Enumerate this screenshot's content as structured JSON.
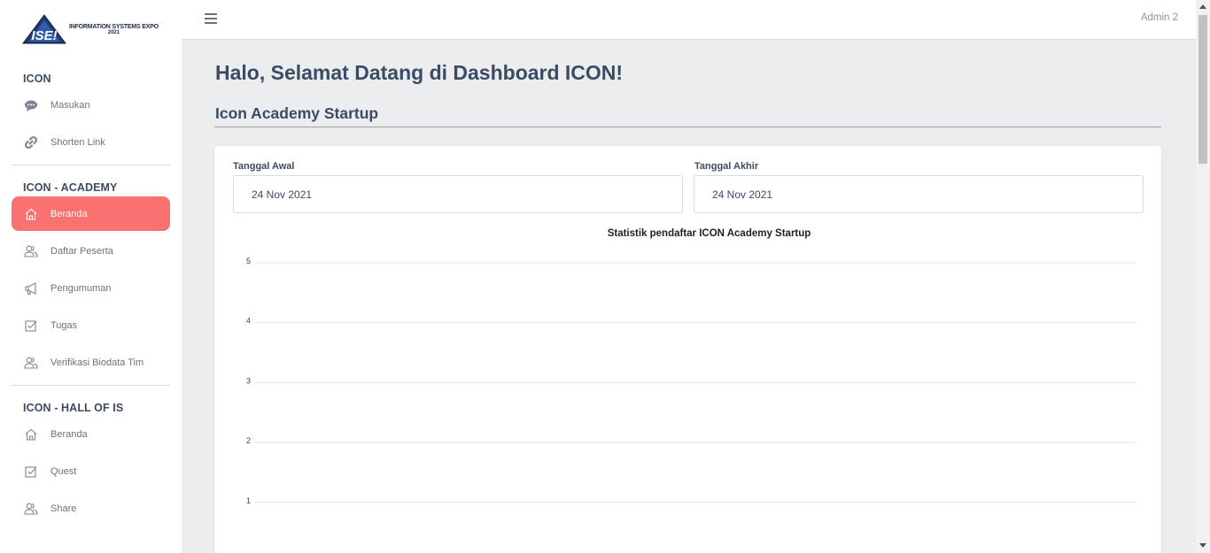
{
  "brand": {
    "logo_mark": "ISE!",
    "logo_line1": "INFORMATION SYSTEMS EXPO",
    "logo_line2": "2021"
  },
  "header": {
    "user": "Admin 2"
  },
  "sidebar": {
    "groups": [
      {
        "title": "ICON",
        "items": [
          {
            "label": "Masukan",
            "icon": "speech-bubble-icon"
          },
          {
            "label": "Shorten Link",
            "icon": "link-icon"
          }
        ]
      },
      {
        "title": "ICON - ACADEMY",
        "items": [
          {
            "label": "Beranda",
            "icon": "home-icon",
            "active": true
          },
          {
            "label": "Daftar Peserta",
            "icon": "people-icon"
          },
          {
            "label": "Pengumuman",
            "icon": "megaphone-icon"
          },
          {
            "label": "Tugas",
            "icon": "checkbox-icon"
          },
          {
            "label": "Verifikasi Biodata Tim",
            "icon": "people-icon"
          }
        ]
      },
      {
        "title": "ICON - HALL OF IS",
        "items": [
          {
            "label": "Beranda",
            "icon": "home-icon"
          },
          {
            "label": "Quest",
            "icon": "checkbox-icon"
          },
          {
            "label": "Share",
            "icon": "people-icon"
          }
        ]
      }
    ]
  },
  "main": {
    "page_title": "Halo, Selamat Datang di Dashboard ICON!",
    "section_title": "Icon Academy Startup",
    "start_date": {
      "label": "Tanggal Awal",
      "value": "24 Nov 2021"
    },
    "end_date": {
      "label": "Tanggal Akhir",
      "value": "24 Nov 2021"
    }
  },
  "colors": {
    "accent": "#f87272",
    "text": "#3c4b64",
    "background": "#ebedef"
  },
  "chart_data": {
    "type": "line",
    "title": "Statistik pendaftar ICON Academy Startup",
    "xlabel": "",
    "ylabel": "",
    "ylim": [
      0,
      5
    ],
    "y_ticks": [
      5,
      4,
      3,
      2,
      1
    ],
    "categories": [],
    "series": [],
    "grid": true
  }
}
